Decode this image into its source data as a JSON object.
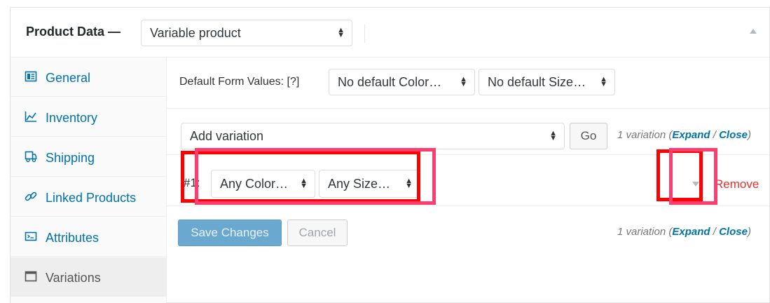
{
  "header": {
    "title": "Product Data —",
    "product_type": "Variable product"
  },
  "sidebar": {
    "items": [
      {
        "label": "General",
        "icon": "general-icon"
      },
      {
        "label": "Inventory",
        "icon": "inventory-icon"
      },
      {
        "label": "Shipping",
        "icon": "shipping-icon"
      },
      {
        "label": "Linked Products",
        "icon": "link-icon"
      },
      {
        "label": "Attributes",
        "icon": "attributes-icon"
      },
      {
        "label": "Variations",
        "icon": "variations-icon",
        "active": true
      }
    ]
  },
  "defaults": {
    "label": "Default Form Values: [?]",
    "color": "No default Color…",
    "size": "No default Size…"
  },
  "add": {
    "select": "Add variation",
    "go": "Go",
    "count": "1 variation (",
    "expand": "Expand",
    "sep": " / ",
    "close": "Close",
    "end": ")"
  },
  "variation": {
    "number": "#1:",
    "color": "Any Color…",
    "size": "Any Size…",
    "remove": "Remove"
  },
  "footer": {
    "save": "Save Changes",
    "cancel": "Cancel",
    "count": "1 variation (",
    "expand": "Expand",
    "sep": " / ",
    "close": "Close",
    "end": ")"
  },
  "colors": {
    "accent": "#0073aa",
    "remove": "#e5322d",
    "highlight_red": "#ff0000",
    "highlight_pink": "#ff3d6e",
    "save_button": "#6aa8cf"
  }
}
